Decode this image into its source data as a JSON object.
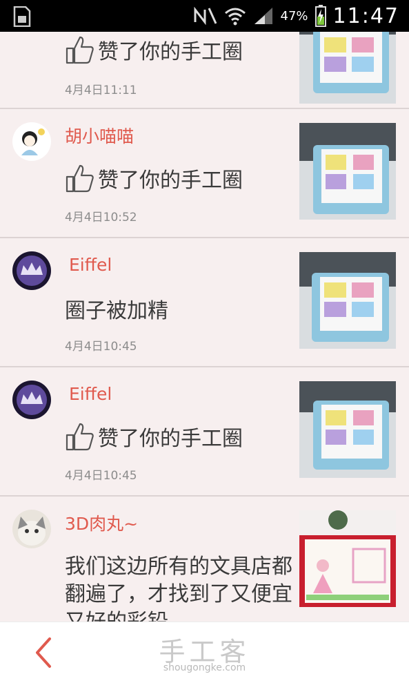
{
  "status_bar": {
    "battery_percent": "47%",
    "time": "11:47",
    "icons": [
      "sim-card-icon",
      "no-notifications-icon",
      "wifi-icon",
      "signal-icon",
      "battery-charging-icon"
    ]
  },
  "feed": [
    {
      "username": "",
      "action": "赞了你的手工圈",
      "time": "4月4日11:11",
      "has_like_icon": true
    },
    {
      "username": "胡小喵喵",
      "action": "赞了你的手工圈",
      "time": "4月4日10:52",
      "has_like_icon": true
    },
    {
      "username": "Eiffel",
      "action": "圈子被加精",
      "time": "4月4日10:45",
      "has_like_icon": false
    },
    {
      "username": "Eiffel",
      "action": "赞了你的手工圈",
      "time": "4月4日10:45",
      "has_like_icon": true
    },
    {
      "username": "3D肉丸~",
      "comment": "我们这边所有的文具店都翻遍了，才找到了又便宜又好的彩铅"
    }
  ],
  "bottom_bar": {
    "brand_cn": "手工客",
    "brand_en": "shougongke.com",
    "back_icon": "chevron-left-icon"
  },
  "colors": {
    "accent": "#e05a4e",
    "background": "#f7efef",
    "divider": "#dcd3d3"
  }
}
